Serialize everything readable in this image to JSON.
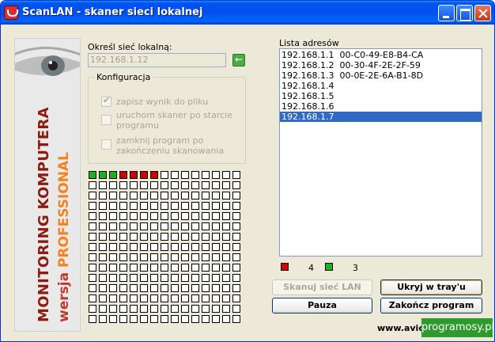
{
  "window": {
    "title": "ScanLAN - skaner sieci lokalnej"
  },
  "banner": {
    "line1": "MONITORING KOMPUTERA",
    "line2_prefix": "wersja",
    "line2_highlight": "PROFESSIONAL"
  },
  "network": {
    "label": "Określ sieć lokalną:",
    "value": "192.168.1.12",
    "go_icon": "arrow-left-icon"
  },
  "config": {
    "legend": "Konfiguracja",
    "options": [
      {
        "label": "zapisz wynik do pliku",
        "checked": true
      },
      {
        "label": "uruchom skaner po starcie programu",
        "checked": false
      },
      {
        "label": "zamknij program po zakończeniu skanowania",
        "checked": false
      }
    ]
  },
  "scan_grid": {
    "columns": 15,
    "rows": 15,
    "states": [
      "green",
      "green",
      "green",
      "red",
      "red",
      "red",
      "red"
    ]
  },
  "list": {
    "label": "Lista adresów",
    "items": [
      {
        "text": "192.168.1.1  00-C0-49-E8-B4-CA",
        "selected": false
      },
      {
        "text": "192.168.1.2  00-30-4F-2E-2F-59",
        "selected": false
      },
      {
        "text": "192.168.1.3  00-0E-2E-6A-B1-8D",
        "selected": false
      },
      {
        "text": "192.168.1.4",
        "selected": false
      },
      {
        "text": "192.168.1.5",
        "selected": false
      },
      {
        "text": "192.168.1.6",
        "selected": false
      },
      {
        "text": "192.168.1.7",
        "selected": true
      }
    ]
  },
  "legend": {
    "red_count": "4",
    "green_count": "3",
    "red_color": "#d40000",
    "green_color": "#19b419"
  },
  "buttons": {
    "scan": "Skanuj sieć LAN",
    "hide": "Ukryj w tray'u",
    "pause": "Pauza",
    "exit": "Zakończ program"
  },
  "footer": {
    "url": "www.avic",
    "watermark": "programosy.pl"
  }
}
